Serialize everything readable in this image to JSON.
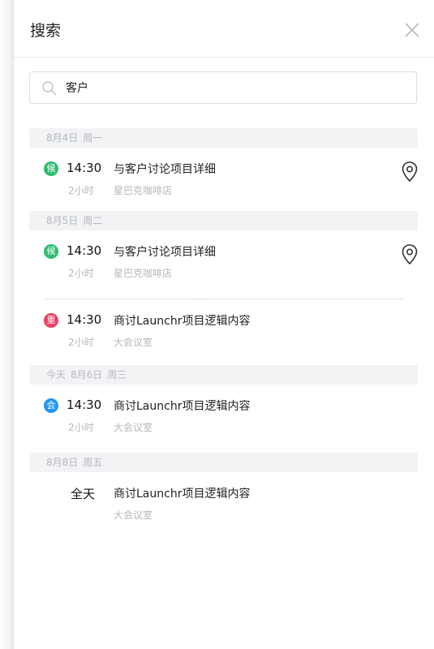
{
  "header": {
    "title": "搜索",
    "close_icon": "close-icon"
  },
  "search": {
    "value": "客户",
    "icon": "search-icon"
  },
  "groups": [
    {
      "date": "8月4日",
      "weekday": "周一",
      "events": [
        {
          "badge": "候",
          "badge_color": "#2fbd72",
          "time": "14:30",
          "duration": "2小时",
          "subject": "与客户讨论项目详细",
          "place": "星巴克咖啡店",
          "has_location": true
        }
      ]
    },
    {
      "date": "8月5日",
      "weekday": "周二",
      "events": [
        {
          "badge": "候",
          "badge_color": "#2fbd72",
          "time": "14:30",
          "duration": "2小时",
          "subject": "与客户讨论项目详细",
          "place": "星巴克咖啡店",
          "has_location": true
        },
        {
          "badge": "重",
          "badge_color": "#ec3f64",
          "time": "14:30",
          "duration": "2小时",
          "subject": "商讨Launchr项目逻辑内容",
          "place": "大会议室",
          "has_location": false
        }
      ]
    },
    {
      "prefix": "今天",
      "date": "8月6日",
      "weekday": "周三",
      "events": [
        {
          "badge": "会",
          "badge_color": "#2196f3",
          "time": "14:30",
          "duration": "2小时",
          "subject": "商讨Launchr项目逻辑内容",
          "place": "大会议室",
          "has_location": false
        }
      ]
    },
    {
      "date": "8月8日",
      "weekday": "周五",
      "events": [
        {
          "time": "全天",
          "subject": "商讨Launchr项目逻辑内容",
          "place": "大会议室",
          "has_location": false
        }
      ]
    }
  ]
}
